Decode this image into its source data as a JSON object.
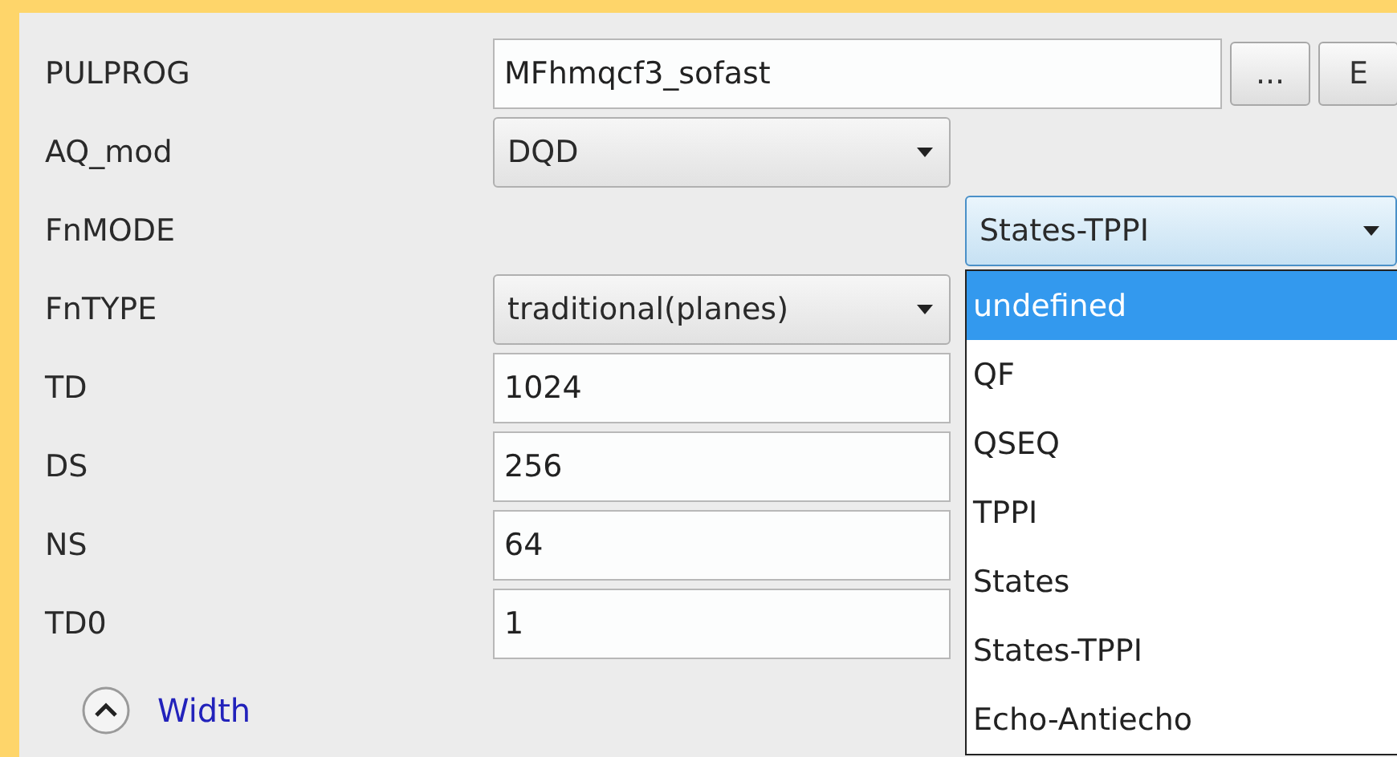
{
  "parameters": [
    {
      "label": "PULPROG",
      "kind": "text-with-buttons",
      "value": "MFhmqcf3_sofast",
      "buttons": [
        "...",
        "E"
      ]
    },
    {
      "label": "AQ_mod",
      "kind": "select",
      "value": "DQD"
    },
    {
      "label": "FnMODE",
      "kind": "dropdown",
      "value": "States-TPPI",
      "open": true,
      "options": [
        {
          "label": "undefined",
          "highlighted": true
        },
        {
          "label": "QF",
          "highlighted": false
        },
        {
          "label": "QSEQ",
          "highlighted": false
        },
        {
          "label": "TPPI",
          "highlighted": false
        },
        {
          "label": "States",
          "highlighted": false
        },
        {
          "label": "States-TPPI",
          "highlighted": false
        },
        {
          "label": "Echo-Antiecho",
          "highlighted": false
        }
      ]
    },
    {
      "label": "FnTYPE",
      "kind": "select",
      "value": "traditional(planes)"
    },
    {
      "label": "TD",
      "kind": "text",
      "value": "1024"
    },
    {
      "label": "DS",
      "kind": "text",
      "value": "256"
    },
    {
      "label": "NS",
      "kind": "text",
      "value": "64"
    },
    {
      "label": "TD0",
      "kind": "text",
      "value": "1"
    }
  ],
  "section": {
    "label": "Width",
    "expanded": true
  }
}
